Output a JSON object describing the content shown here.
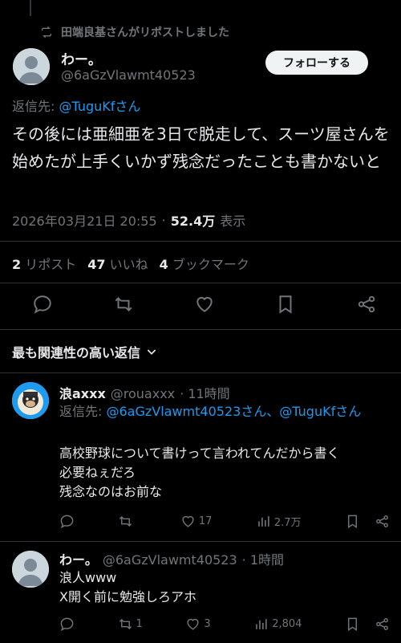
{
  "repost_banner": {
    "text": "田端良基さんがリポストしました"
  },
  "main_tweet": {
    "name": "わー。",
    "handle": "@6aGzVlawmt40523",
    "follow_label": "フォローする",
    "reply_to_prefix": "返信先: ",
    "reply_to_user": "@TuguKfさん",
    "text": "その後には亜細亜を3日で脱走して、スーツ屋さんを始めたが上手くいかず残念だったことも書かないと",
    "timestamp": "2026年03月21日 20:55",
    "views_count": "52.4万",
    "views_label": "表示",
    "stats": {
      "reposts_count": "2",
      "reposts_label": "リポスト",
      "likes_count": "47",
      "likes_label": "いいね",
      "bookmarks_count": "4",
      "bookmarks_label": "ブックマーク"
    }
  },
  "sort_label": "最も関連性の高い返信",
  "replies": [
    {
      "name": "浪axxx",
      "handle": "@rouaxxx",
      "time": "· 11時間",
      "reply_to_prefix": "返信先: ",
      "reply_to_users": "@6aGzVlawmt40523さん、@TuguKfさん",
      "lines": [
        "高校野球について書けって言われてんだから書く",
        "必要ねぇだろ",
        "残念なのはお前な"
      ],
      "reposts": "",
      "likes": "17",
      "views": "2.7万"
    },
    {
      "name": "わー。",
      "handle": "@6aGzVlawmt40523",
      "time": "· 1時間",
      "lines": [
        "浪人www",
        "X開く前に勉強しろアホ"
      ],
      "reposts": "1",
      "likes": "3",
      "views": "2,804"
    }
  ],
  "icons": [
    "repost-icon",
    "reply-icon",
    "like-icon",
    "bookmark-icon",
    "share-icon",
    "views-icon",
    "chevron-down-icon"
  ]
}
